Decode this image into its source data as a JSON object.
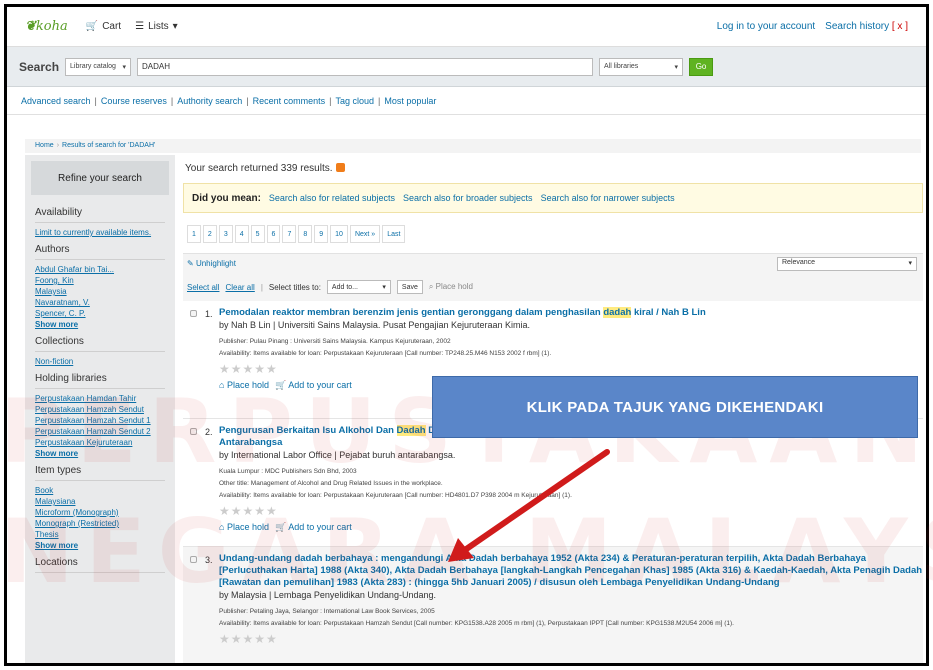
{
  "topbar": {
    "logo": "koha",
    "cart": "Cart",
    "lists": "Lists",
    "login": "Log in to your account",
    "history": "Search history",
    "history_clear": "[ x ]"
  },
  "search": {
    "label": "Search",
    "catalog": "Library catalog",
    "query": "DADAH",
    "libraries": "All libraries",
    "go": "Go"
  },
  "links": [
    "Advanced search",
    "Course reserves",
    "Authority search",
    "Recent comments",
    "Tag cloud",
    "Most popular"
  ],
  "breadcrumb": {
    "home": "Home",
    "current": "Results of search for 'DADAH'"
  },
  "sidebar": {
    "refine": "Refine your search",
    "availability": {
      "heading": "Availability",
      "link": "Limit to currently available items."
    },
    "authors": {
      "heading": "Authors",
      "items": [
        "Abdul Ghafar bin Tai...",
        "Foong, Kin",
        "Malaysia",
        "Navaratnam, V.",
        "Spencer, C. P."
      ],
      "more": "Show more"
    },
    "collections": {
      "heading": "Collections",
      "items": [
        "Non-fiction"
      ]
    },
    "holding": {
      "heading": "Holding libraries",
      "items": [
        "Perpustakaan Hamdan Tahir",
        "Perpustakaan Hamzah Sendut",
        "Perpustakaan Hamzah Sendut 1",
        "Perpustakaan Hamzah Sendut 2",
        "Perpustakaan Kejuruteraan"
      ],
      "more": "Show more"
    },
    "itemtypes": {
      "heading": "Item types",
      "items": [
        "Book",
        "Malaysiana",
        "Microform (Monograph)",
        "Monograph (Restricted)",
        "Thesis"
      ],
      "more": "Show more"
    },
    "locations": {
      "heading": "Locations"
    }
  },
  "main": {
    "count": "Your search returned 339 results.",
    "dym": {
      "label": "Did you mean:",
      "links": [
        "Search also for related subjects",
        "Search also for broader subjects",
        "Search also for narrower subjects"
      ]
    },
    "pages": [
      "1",
      "2",
      "3",
      "4",
      "5",
      "6",
      "7",
      "8",
      "9",
      "10",
      "Next »",
      "Last"
    ],
    "unhighlight": "Unhighlight",
    "sort": "Relevance",
    "select_all": "Select all",
    "clear_all": "Clear all",
    "select_titles": "Select titles to:",
    "add_to": "Add to...",
    "save": "Save",
    "place_hold": "Place hold",
    "results": [
      {
        "num": "1.",
        "title_pre": "Pemodalan reaktor membran berenzim jenis gentian geronggang dalam penghasilan ",
        "title_hl": "dadah",
        "title_post": " kiral / Nah B Lin",
        "author": "by Nah B Lin | Universiti Sains Malaysia. Pusat Pengajian Kejuruteraan Kimia.",
        "publisher": "Publisher: Pulau Pinang : Universiti Sains Malaysia. Kampus Kejuruteraan, 2002",
        "availability": "Availability: Items available for loan: Perpustakaan Kejuruteraan [Call number: TP248.25.M46 N153 2002 f rbm] (1)."
      },
      {
        "num": "2.",
        "title_pre": "Pengurusan Berkaitan Isu Alkohol Dan ",
        "title_hl": "Dadah",
        "title_post": " Di Tempat Kerja=Management of Alcohol and Drug Related Issues in the workplace / Pejabat Buruh Antarabangsa",
        "author": "by International Labor Office | Pejabat buruh antarabangsa.",
        "publisher": "Kuala Lumpur : MDC Publishers Sdn Bhd, 2003",
        "other": "Other title: Management of Alcohol and Drug Related Issues in the workplace.",
        "availability": "Availability: Items available for loan: Perpustakaan Kejuruteraan [Call number: HD4801.D7 P398 2004 m Kejuruteraan] (1)."
      },
      {
        "num": "3.",
        "title": "Undang-undang dadah berbahaya : mengandungi Akta Dadah berbahaya 1952 (Akta 234) & Peraturan-peraturan terpilih, Akta Dadah Berbahaya [Perlucuthakan Harta] 1988 (Akta 340), Akta Dadah Berbahaya [langkah-Langkah Pencegahan Khas] 1985 (Akta 316) & Kaedah-Kaedah, Akta Penagih Dadah [Rawatan dan pemulihan] 1983 (Akta 283) : (hingga 5hb Januari 2005) / disusun oleh Lembaga Penyelidikan Undang-Undang",
        "author": "by Malaysia | Lembaga Penyelidikan Undang-Undang.",
        "publisher": "Publisher: Petaling Jaya, Selangor : International Law Book Services, 2005",
        "availability": "Availability: Items available for loan: Perpustakaan Hamzah Sendut [Call number: KPG1538.A28 2005 m rbm] (1), Perpustakaan IPPT [Call number: KPG1538.M2U54 2006 m] (1)."
      }
    ],
    "add_cart": "Add to your cart"
  },
  "watermark": {
    "line1": "PERPUSTAKAAN",
    "line2": "NEGARA MALAYSIA"
  },
  "callout": "KLIK PADA TAJUK YANG DIKEHENDAKI",
  "colors": {
    "link": "#0b6fa7",
    "go": "#5fb321",
    "callout": "#5a86c9",
    "arrow": "#d01b1b"
  }
}
